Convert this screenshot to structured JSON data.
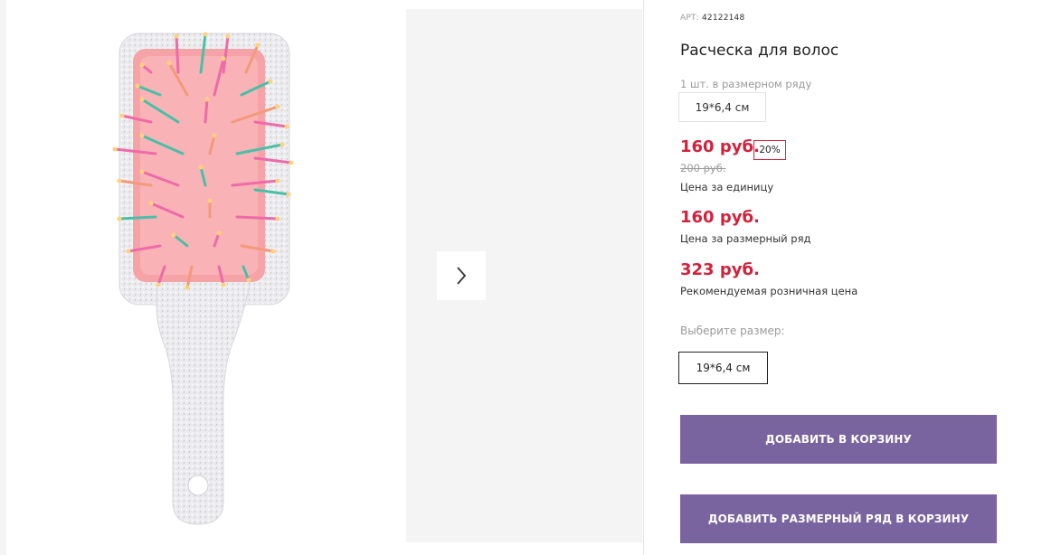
{
  "gallery": {
    "main_image": "hairbrush-glitter-product-photo",
    "next_icon": "chevron-right-icon"
  },
  "product": {
    "sku_label": "АРТ:",
    "sku_value": "42122148",
    "title": "Расческа для волос",
    "pack_label": "1 шт. в размерном ряду",
    "pack_size": "19*6,4 см"
  },
  "pricing": {
    "unit_price": "160 руб.",
    "discount": "20%",
    "old_price": "200 руб.",
    "unit_caption": "Цена за единицу",
    "row_price": "160 руб.",
    "row_caption": "Цена за размерный ряд",
    "rrp_price": "323 руб.",
    "rrp_caption": "Рекомендуемая розничная цена"
  },
  "size_picker": {
    "label": "Выберите размер:",
    "selected": "19*6,4 см"
  },
  "actions": {
    "add_to_cart": "ДОБАВИТЬ В КОРЗИНУ",
    "add_row_to_cart": "ДОБАВИТЬ РАЗМЕРНЫЙ РЯД В КОРЗИНУ"
  },
  "colors": {
    "accent_button": "#7a64a0",
    "price_red": "#d4213b"
  }
}
